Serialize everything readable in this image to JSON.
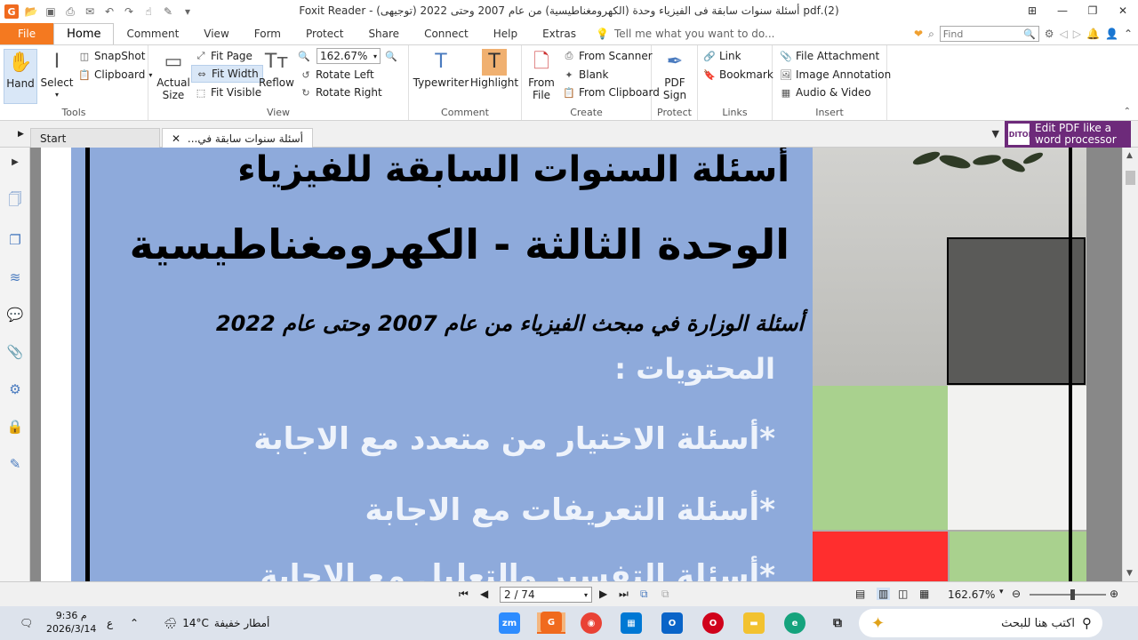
{
  "title_bar": {
    "title": "(2).pdf أسئلة سنوات سابقة فى الفيزياء وحدة (الكهرومغناطيسية) من عام 2007 وحتى 2022 (توجيهى) - Foxit Reader",
    "quick_access_icons": [
      "open-icon",
      "save-icon",
      "print-icon",
      "email-icon",
      "undo-icon",
      "redo-icon",
      "hand-tool-icon",
      "pen-icon",
      "dropdown-icon"
    ],
    "window_controls": [
      "ribbon-options-icon",
      "minimize-icon",
      "restore-icon",
      "close-icon"
    ]
  },
  "menu": {
    "tabs": [
      "File",
      "Home",
      "Comment",
      "View",
      "Form",
      "Protect",
      "Share",
      "Connect",
      "Help",
      "Extras"
    ],
    "active_tab": "Home",
    "tell_me": "Tell me what you want to do...",
    "find_placeholder": "Find"
  },
  "ribbon": {
    "tools": {
      "label": "Tools",
      "hand": "Hand",
      "select": "Select",
      "snapshot": "SnapShot",
      "clipboard": "Clipboard"
    },
    "view": {
      "label": "View",
      "actual_size_1": "Actual",
      "actual_size_2": "Size",
      "fit_page": "Fit Page",
      "fit_width": "Fit Width",
      "fit_visible": "Fit Visible",
      "reflow": "Reflow",
      "zoom_value": "162.67%",
      "rotate_left": "Rotate Left",
      "rotate_right": "Rotate Right"
    },
    "comment": {
      "label": "Comment",
      "typewriter": "Typewriter",
      "highlight": "Highlight"
    },
    "create": {
      "label": "Create",
      "from_file_1": "From",
      "from_file_2": "File",
      "from_scanner": "From Scanner",
      "blank": "Blank",
      "from_clipboard": "From Clipboard"
    },
    "protect": {
      "label": "Protect",
      "pdf_sign_1": "PDF",
      "pdf_sign_2": "Sign"
    },
    "links": {
      "label": "Links",
      "link": "Link",
      "bookmark": "Bookmark"
    },
    "insert": {
      "label": "Insert",
      "file_attachment": "File Attachment",
      "image_annotation": "Image Annotation",
      "audio_video": "Audio & Video"
    }
  },
  "doc_tabs": {
    "start": "Start",
    "current": "أسئلة سنوات سابقة في...",
    "promo_line1": "Edit PDF like a",
    "promo_line2": "word processor",
    "promo_logo": "EDITOR"
  },
  "document": {
    "title": "أسئلة السنوات السابقة للفيزياء",
    "unit": "الوحدة الثالثة  - الكهرومغناطيسية",
    "years": "أسئلة الوزارة في مبحث الفيزياء من عام 2007 وحتى عام 2022",
    "contents_heading": "المحتويات  :",
    "items": [
      "*أسئلة الاختيار من متعدد مع الاجابة",
      "*أسئلة التعريفات مع الاجابة",
      "*أسئلة التفسير والتعليل مع الاجابة"
    ],
    "colors": {
      "blue_panel": "#8eaadb",
      "green": "#a9d18e",
      "red": "#ff2e2e",
      "dark_box": "#5a5a58"
    }
  },
  "status_bar": {
    "page_display": "2 / 74",
    "zoom": "162.67%"
  },
  "taskbar": {
    "time": "9:36 م",
    "date": "2026/3/14",
    "lang": "ع",
    "weather_temp": "14°C",
    "weather_text": "أمطار خفيفة",
    "search_placeholder": "اكتب هنا للبحث",
    "apps": [
      "zoom-app",
      "foxit-app",
      "chrome-app",
      "store-app",
      "outlook-app",
      "opera-app",
      "explorer-app",
      "edge-app",
      "taskview-app"
    ]
  }
}
